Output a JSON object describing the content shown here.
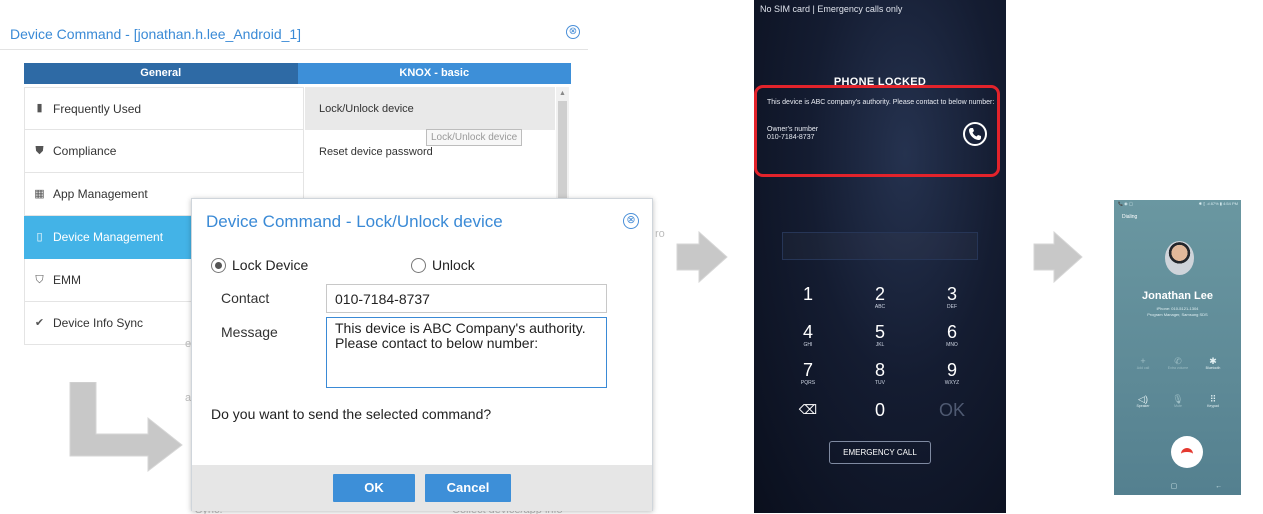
{
  "outer_panel": {
    "title": "Device Command - [jonathan.h.lee_Android_1]",
    "close_glyph": "⊗",
    "tabs": [
      {
        "label": "General"
      },
      {
        "label": "KNOX - basic"
      }
    ],
    "categories": [
      {
        "label": "Frequently Used",
        "icon": "bookmark-icon",
        "glyph": "▮"
      },
      {
        "label": "Compliance",
        "icon": "shield-icon",
        "glyph": "⛊"
      },
      {
        "label": "App Management",
        "icon": "grid-icon",
        "glyph": "▦"
      },
      {
        "label": "Device Management",
        "icon": "phone-icon",
        "glyph": "▯"
      },
      {
        "label": "EMM",
        "icon": "shield-gear-icon",
        "glyph": "⛉"
      },
      {
        "label": "Device Info Sync",
        "icon": "check-circle-icon",
        "glyph": "✔"
      }
    ],
    "commands": [
      {
        "label": "Lock/Unlock device"
      },
      {
        "label": "Reset device password"
      }
    ],
    "tooltip": "Lock/Unlock device",
    "bg_text": {
      "ro": "ro",
      "a": "a",
      "e": "e",
      "sync": "Sync.",
      "collect": "Collect device/app info"
    }
  },
  "modal": {
    "title": "Device Command - Lock/Unlock device",
    "close_glyph": "⊗",
    "options": {
      "lock": "Lock Device",
      "unlock": "Unlock",
      "selected": "lock"
    },
    "contact_label": "Contact",
    "contact_value": "010-7184-8737",
    "message_label": "Message",
    "message_value": "This device is ABC Company's authority. Please contact to below number:",
    "question": "Do you want to send the selected command?",
    "ok_label": "OK",
    "cancel_label": "Cancel"
  },
  "locked_phone": {
    "status": "No SIM card | Emergency calls only",
    "heading": "PHONE LOCKED",
    "message": "This device is ABC company's authority. Please contact to below number:",
    "owner_label": "Owner's number",
    "owner_number": "010-7184-8737",
    "keys": [
      {
        "num": "1",
        "sub": ""
      },
      {
        "num": "2",
        "sub": "ABC"
      },
      {
        "num": "3",
        "sub": "DEF"
      },
      {
        "num": "4",
        "sub": "GHI"
      },
      {
        "num": "5",
        "sub": "JKL"
      },
      {
        "num": "6",
        "sub": "MNO"
      },
      {
        "num": "7",
        "sub": "PQRS"
      },
      {
        "num": "8",
        "sub": "TUV"
      },
      {
        "num": "9",
        "sub": "WXYZ"
      },
      {
        "num": "⌫",
        "sub": ""
      },
      {
        "num": "0",
        "sub": ""
      },
      {
        "num": "OK",
        "sub": ""
      }
    ],
    "emergency_label": "EMERGENCY CALL",
    "accent": "#e2232b"
  },
  "call_screen": {
    "status_left": "📞 ◉ ◯",
    "status_right": "✱ ▯ .ıl 87% ▮ 4:54 PM",
    "state": "Dialing",
    "name": "Jonathan Lee",
    "line1": "iPhone: 010-5121-1304",
    "line2": "Program Manager, Samsung SDS",
    "controls": [
      {
        "glyph": "+",
        "label": "Add call",
        "dim": true
      },
      {
        "glyph": "✆",
        "label": "Extra volume",
        "dim": true
      },
      {
        "glyph": "✱",
        "label": "Bluetooth",
        "dim": false
      },
      {
        "glyph": "◁)",
        "label": "Speaker",
        "dim": false
      },
      {
        "glyph": "🎙",
        "label": "Mute",
        "dim": true
      },
      {
        "glyph": "⠿",
        "label": "Keypad",
        "dim": false
      }
    ],
    "nav": [
      "",
      "▢",
      "←"
    ]
  }
}
